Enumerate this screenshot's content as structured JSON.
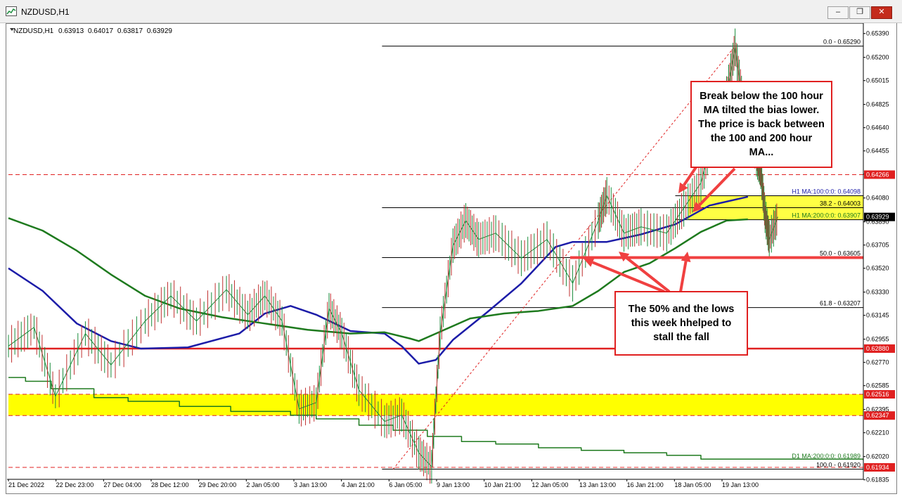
{
  "window": {
    "title": "NZDUSD,H1",
    "buttons": [
      "minimize",
      "restore",
      "close"
    ],
    "icon": "chart-window-icon"
  },
  "chart_data": {
    "type": "line",
    "symbol_label": "NZDUSD,H1",
    "ohlc": [
      "0.63913",
      "0.64017",
      "0.63817",
      "0.63929"
    ],
    "ylim": [
      0.6185,
      0.6545
    ],
    "y_ticks": [
      "0.65390",
      "0.65200",
      "0.65015",
      "0.64825",
      "0.64640",
      "0.64455",
      "0.64270",
      "0.64080",
      "0.63890",
      "0.63705",
      "0.63520",
      "0.63330",
      "0.63145",
      "0.62955",
      "0.62770",
      "0.62585",
      "0.62395",
      "0.62210",
      "0.62020",
      "0.61835"
    ],
    "x_ticks": [
      "21 Dec 2022",
      "22 Dec 23:00",
      "27 Dec 04:00",
      "28 Dec 12:00",
      "29 Dec 20:00",
      "2 Jan 05:00",
      "3 Jan 13:00",
      "4 Jan 21:00",
      "6 Jan 05:00",
      "9 Jan 13:00",
      "10 Jan 21:00",
      "12 Jan 05:00",
      "13 Jan 13:00",
      "16 Jan 21:00",
      "18 Jan 05:00",
      "19 Jan 13:00"
    ],
    "price_labels": [
      {
        "value": 0.64266,
        "text": "0.64266",
        "color": "#e02020",
        "style": "dashed"
      },
      {
        "value": 0.63929,
        "text": "0.63929",
        "color": "#000000",
        "style": "current"
      },
      {
        "value": 0.6288,
        "text": "0.62880",
        "color": "#e02020",
        "style": "solid"
      },
      {
        "value": 0.62516,
        "text": "0.62516",
        "color": "#e02020",
        "style": "dashed"
      },
      {
        "value": 0.62347,
        "text": "0.62347",
        "color": "#e02020",
        "style": "dashed"
      },
      {
        "value": 0.61934,
        "text": "0.61934",
        "color": "#e02020",
        "style": "dashed"
      }
    ],
    "fib_levels": [
      {
        "text": "0.0 - 0.65290",
        "value": 0.6529
      },
      {
        "text": "38.2 - 0.64003",
        "value": 0.64003
      },
      {
        "text": "50.0 - 0.63605",
        "value": 0.63605
      },
      {
        "text": "61.8 - 0.63207",
        "value": 0.63207
      },
      {
        "text": "100.0 - 0.61920",
        "value": 0.6192
      }
    ],
    "ma_labels": [
      {
        "text": "H1 MA:100:0:0: 0.64098",
        "value": 0.64098,
        "color": "#1c1ca8"
      },
      {
        "text": "H1 MA:200:0:0: 0.63907",
        "value": 0.63907,
        "color": "#1e7a1e"
      },
      {
        "text": "D1 MA:200:0:0: 0.61989",
        "value": 0.61989,
        "color": "#1e7a1e"
      }
    ],
    "zones": [
      {
        "from": 0.62347,
        "to": 0.62516,
        "color": "#ffff00"
      },
      {
        "from": 0.63907,
        "to": 0.64098,
        "color": "#ffff44"
      }
    ],
    "series": [
      {
        "key": "ma100",
        "color": "#1c1ca8",
        "width": 2.5,
        "x": [
          0,
          0.04,
          0.08,
          0.12,
          0.155,
          0.21,
          0.27,
          0.3,
          0.33,
          0.36,
          0.4,
          0.44,
          0.46,
          0.48,
          0.5,
          0.52,
          0.56,
          0.6,
          0.64,
          0.66,
          0.7,
          0.74,
          0.78,
          0.82,
          0.865
        ],
        "y": [
          0.6352,
          0.6334,
          0.6308,
          0.6294,
          0.6288,
          0.6289,
          0.63,
          0.6316,
          0.6322,
          0.6315,
          0.6302,
          0.63,
          0.629,
          0.6276,
          0.6279,
          0.6295,
          0.6317,
          0.634,
          0.6369,
          0.6373,
          0.6373,
          0.6379,
          0.6387,
          0.6402,
          0.6409
        ]
      },
      {
        "key": "ma200",
        "color": "#1e7a1e",
        "width": 2.5,
        "x": [
          0,
          0.04,
          0.08,
          0.12,
          0.16,
          0.2,
          0.25,
          0.3,
          0.35,
          0.4,
          0.44,
          0.47,
          0.48,
          0.5,
          0.54,
          0.58,
          0.62,
          0.66,
          0.69,
          0.72,
          0.75,
          0.78,
          0.81,
          0.84,
          0.865
        ],
        "y": [
          0.6392,
          0.6382,
          0.6366,
          0.6347,
          0.633,
          0.632,
          0.6313,
          0.6308,
          0.6303,
          0.63,
          0.6301,
          0.6296,
          0.6294,
          0.63,
          0.6312,
          0.6316,
          0.6318,
          0.6322,
          0.6334,
          0.6349,
          0.6356,
          0.6368,
          0.6381,
          0.639,
          0.6391
        ]
      },
      {
        "key": "d1ma200",
        "color": "#1e7a1e",
        "width": 1.5,
        "step": true,
        "x": [
          0,
          0.02,
          0.05,
          0.1,
          0.14,
          0.2,
          0.26,
          0.33,
          0.36,
          0.41,
          0.45,
          0.49,
          0.53,
          0.57,
          0.62,
          0.67,
          0.72,
          0.77,
          0.81,
          1.0
        ],
        "y": [
          0.6265,
          0.6262,
          0.6256,
          0.6249,
          0.6246,
          0.6242,
          0.6238,
          0.6235,
          0.6232,
          0.6227,
          0.6223,
          0.6218,
          0.6214,
          0.6212,
          0.6209,
          0.6207,
          0.6205,
          0.6203,
          0.62,
          0.6199
        ]
      },
      {
        "key": "price",
        "color": "#1a8c3c",
        "width": 1,
        "x": [
          0,
          0.03,
          0.055,
          0.09,
          0.12,
          0.16,
          0.19,
          0.22,
          0.255,
          0.28,
          0.3,
          0.32,
          0.34,
          0.36,
          0.375,
          0.39,
          0.41,
          0.44,
          0.46,
          0.48,
          0.495,
          0.505,
          0.52,
          0.535,
          0.55,
          0.57,
          0.6,
          0.63,
          0.66,
          0.69,
          0.7,
          0.72,
          0.74,
          0.77,
          0.79,
          0.81,
          0.825,
          0.84,
          0.85,
          0.86,
          0.875,
          0.88,
          0.885,
          0.89,
          0.9
        ],
        "y": [
          0.629,
          0.6305,
          0.625,
          0.63,
          0.6275,
          0.631,
          0.633,
          0.631,
          0.6335,
          0.6315,
          0.633,
          0.631,
          0.624,
          0.6245,
          0.632,
          0.63,
          0.6255,
          0.623,
          0.6235,
          0.6205,
          0.6194,
          0.63,
          0.637,
          0.639,
          0.6375,
          0.638,
          0.636,
          0.6375,
          0.634,
          0.639,
          0.641,
          0.638,
          0.6385,
          0.638,
          0.64,
          0.642,
          0.646,
          0.649,
          0.6528,
          0.648,
          0.644,
          0.643,
          0.6395,
          0.6375,
          0.6393
        ]
      }
    ],
    "diagonal": {
      "from": [
        0.45,
        0.6192
      ],
      "to": [
        0.85,
        0.6529
      ]
    },
    "grid": false
  },
  "annotations": {
    "callout_1": "Break below the 100 hour MA tilted the bias lower. The price is back between the 100 and 200 hour MA...",
    "callout_2": "The 50% and the lows this week hhelped to stall the fall"
  }
}
